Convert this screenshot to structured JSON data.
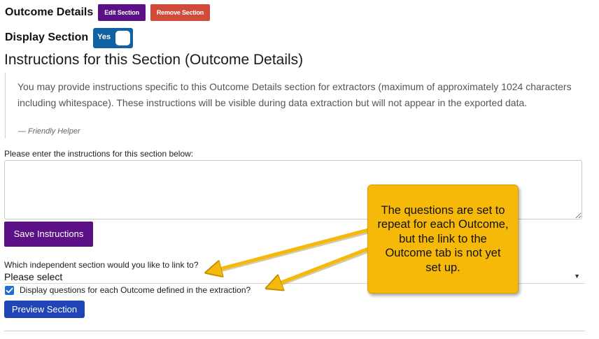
{
  "header": {
    "section_name": "Outcome Details",
    "edit_label": "Edit Section",
    "remove_label": "Remove Section"
  },
  "display": {
    "label": "Display Section",
    "toggle_value": "Yes",
    "toggle_on": true
  },
  "instructions": {
    "title": "Instructions for this Section (Outcome Details)",
    "helper_text": "You may provide instructions specific to this Outcome Details section for extractors (maximum of approximately 1024 characters including whitespace). These instructions will be visible during data extraction but will not appear in the exported data.",
    "helper_footer": "— Friendly Helper",
    "enter_label": "Please enter the instructions for this section below:",
    "textarea_value": "",
    "save_label": "Save Instructions"
  },
  "linking": {
    "label": "Which independent section would you like to link to?",
    "selected": "Please select",
    "checkbox_label": "Display questions for each Outcome defined in the extraction?",
    "checkbox_checked": true
  },
  "preview_label": "Preview Section",
  "callout": {
    "text": "The questions are set to repeat for each Outcome, but the link to the Outcome tab is not yet set up."
  },
  "colors": {
    "purple": "#5b1185",
    "red": "#d04b3a",
    "toggle_blue": "#1162a4",
    "preview_blue": "#1f44b5",
    "callout_yellow": "#f6b90a"
  },
  "icons": {
    "select_caret": "▼",
    "check": "checkmark-icon",
    "resize": "resize-grip-icon"
  }
}
